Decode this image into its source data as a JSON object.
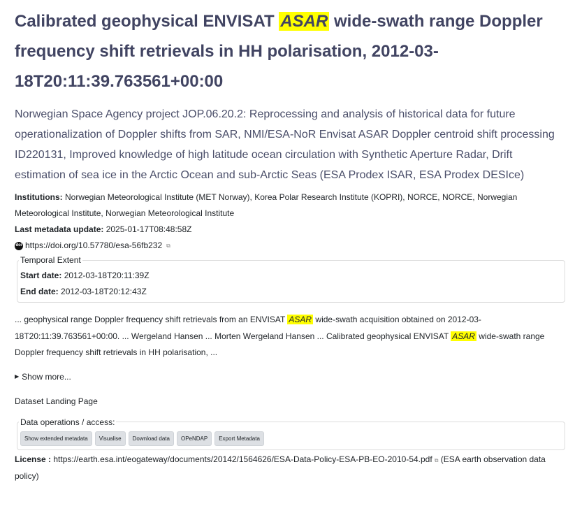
{
  "title": {
    "before": "Calibrated geophysical ENVISAT ",
    "highlight": "ASAR",
    "after": " wide-swath range Doppler frequency shift retrievals in HH polarisation, 2012-03-18T20:11:39.763561+00:00"
  },
  "summary": "Norwegian Space Agency project JOP.06.20.2: Reprocessing and analysis of historical data for future operationalization of Doppler shifts from SAR, NMI/ESA-NoR Envisat ASAR Doppler centroid shift processing ID220131, Improved knowledge of high latitude ocean circulation with Synthetic Aperture Radar, Drift estimation of sea ice in the Arctic Ocean and sub-Arctic Seas (ESA Prodex ISAR, ESA Prodex DESIce)",
  "institutions": {
    "label": "Institutions:",
    "value": "Norwegian Meteorological Institute (MET Norway), Korea Polar Research Institute (KOPRI), NORCE, NORCE, Norwegian Meteorological Institute, Norwegian Meteorological Institute"
  },
  "last_update": {
    "label": "Last metadata update:",
    "value": "2025-01-17T08:48:58Z"
  },
  "doi": {
    "icon_text": "doi",
    "url": "https://doi.org/10.57780/esa-56fb232"
  },
  "temporal": {
    "legend": "Temporal Extent",
    "start_label": "Start date:",
    "start_value": "2012-03-18T20:11:39Z",
    "end_label": "End date:",
    "end_value": "2012-03-18T20:12:43Z"
  },
  "snippet": {
    "part1": "... geophysical range Doppler frequency shift retrievals from an ENVISAT ",
    "hl1": "ASAR",
    "part2": " wide-swath acquisition obtained on 2012-03-18T20:11:39.763561+00:00. ... Wergeland Hansen ... Morten Wergeland Hansen ... Calibrated geophysical ENVISAT ",
    "hl2": "ASAR",
    "part3": " wide-swath range Doppler frequency shift retrievals in HH polarisation, ..."
  },
  "show_more": "Show more...",
  "landing_page": "Dataset Landing Page",
  "data_ops": {
    "legend": "Data operations / access:",
    "buttons": {
      "extended": "Show extended metadata",
      "visualise": "Visualise",
      "download": "Download data",
      "opendap": "OPeNDAP",
      "export": "Export Metadata"
    }
  },
  "license": {
    "label": "License :",
    "url": "https://earth.esa.int/eogateway/documents/20142/1564626/ESA-Data-Policy-ESA-PB-EO-2010-54.pdf",
    "note": "(ESA earth observation data policy)"
  },
  "icons": {
    "external": "external-link-icon",
    "doi": "doi-icon",
    "triangle": "triangle-right-icon"
  },
  "colors": {
    "title": "#414462",
    "highlight": "#ffff00",
    "button_bg": "#dde0e4"
  }
}
